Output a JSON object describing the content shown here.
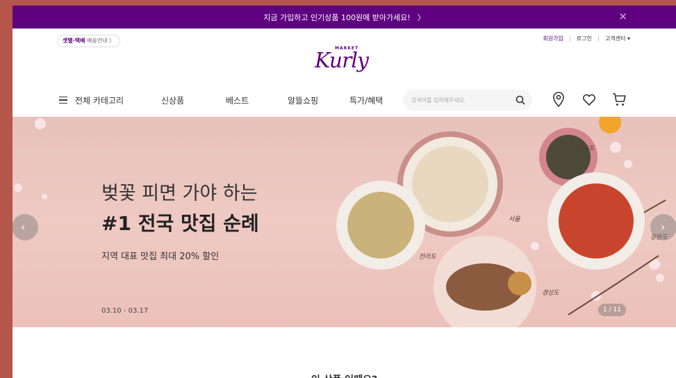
{
  "promo": {
    "text": "지금 가입하고 인기상품 100원에 받아가세요!",
    "arrow": "〉",
    "close": "✕"
  },
  "header": {
    "delivery_badge_brand": "샛별·택배",
    "delivery_badge_text": "배송안내 〉",
    "logo_market": "MARKET",
    "logo_kurly": "Kurly",
    "user_menu": {
      "signup": "회원가입",
      "login": "로그인",
      "customer_center": "고객센터 ▾"
    }
  },
  "nav": {
    "items": [
      {
        "label": "전체 카테고리"
      },
      {
        "label": "신상품"
      },
      {
        "label": "베스트"
      },
      {
        "label": "알뜰쇼핑"
      },
      {
        "label": "특가/혜택"
      }
    ],
    "search_placeholder": "검색어를 입력해주세요."
  },
  "hero": {
    "title_line1": "벚꽃 피면 가야 하는",
    "title_line2": "#1 전국 맛집 순례",
    "subtitle": "지역 대표 맛집 최대 20% 할인",
    "date": "03.10 - 03.17",
    "counter": "1 / 11",
    "regions": [
      "제주도",
      "서울",
      "전라도",
      "경상도",
      "강원도"
    ],
    "prev_icon": "‹",
    "next_icon": "›"
  },
  "section": {
    "title": "이 상품 어때요?"
  },
  "colors": {
    "brand": "#5f0080",
    "hero_bg": "#ecc3bc",
    "outer": "#b5564b"
  },
  "icons": [
    "menu-icon",
    "search-icon",
    "location-pin-icon",
    "heart-icon",
    "cart-icon",
    "close-icon",
    "chevron-left-icon",
    "chevron-right-icon"
  ]
}
